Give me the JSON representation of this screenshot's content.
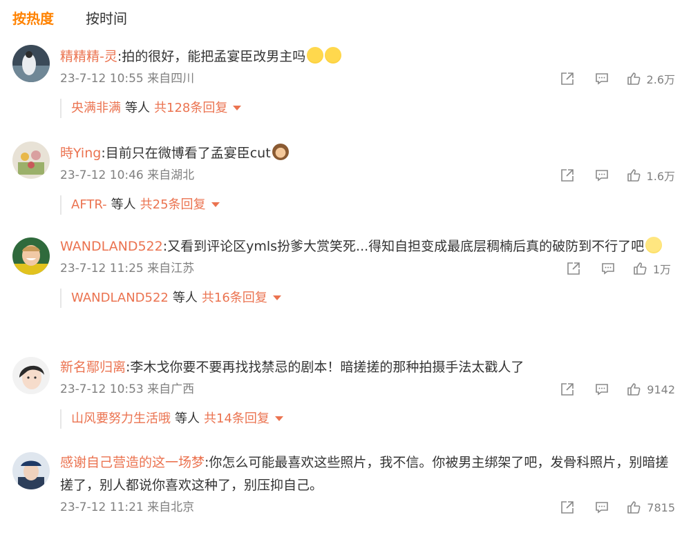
{
  "tabs": [
    {
      "label": "按热度",
      "active": true
    },
    {
      "label": "按时间",
      "active": false
    }
  ],
  "colors": {
    "accent": "#ff8200",
    "username": "#eb7350",
    "meta": "#808080"
  },
  "comments": [
    {
      "user": "精精精-灵",
      "text": ":拍的很好，能把孟宴臣改男主吗",
      "emojis": [
        "scream-emoji",
        "scream-emoji"
      ],
      "time": "23-7-12 10:55 来自四川",
      "likes": "2.6万",
      "reply_users": "央满非满",
      "reply_mid": "等人",
      "reply_total": "共128条回复"
    },
    {
      "user": "時Ying",
      "text": ":目前只在微博看了孟宴臣cut",
      "emojis": [
        "see-no-evil-monkey-emoji"
      ],
      "time": "23-7-12 10:46 来自湖北",
      "likes": "1.6万",
      "reply_users": "AFTR-",
      "reply_mid": "等人",
      "reply_total": "共25条回复"
    },
    {
      "user": "WANDLAND522",
      "text": ":又看到评论区ymls扮爹大赏笑死...得知自担变成最底层稠楠后真的破防到不行了吧",
      "emojis": [
        "thinking-emoji"
      ],
      "time": "23-7-12 11:25 来自江苏",
      "likes": "1万",
      "reply_users": "WANDLAND522",
      "reply_mid": "等人",
      "reply_total": "共16条回复"
    },
    {
      "user": "新名鄢归离",
      "text": ":李木戈你要不要再找找禁忌的剧本！暗搓搓的那种拍摄手法太戳人了",
      "emojis": [],
      "time": "23-7-12 10:53 来自广西",
      "likes": "9142",
      "reply_users": "山风要努力生活哦",
      "reply_mid": "等人",
      "reply_total": "共14条回复"
    },
    {
      "user": "感谢自己营造的这一场梦",
      "text": ":你怎么可能最喜欢这些照片，我不信。你被男主绑架了吧，发骨科照片，别暗搓搓了，别人都说你喜欢这种了，别压抑自己。",
      "emojis": [],
      "time": "23-7-12 11:21 来自北京",
      "likes": "7815",
      "reply_users": null,
      "reply_mid": null,
      "reply_total": null
    }
  ]
}
